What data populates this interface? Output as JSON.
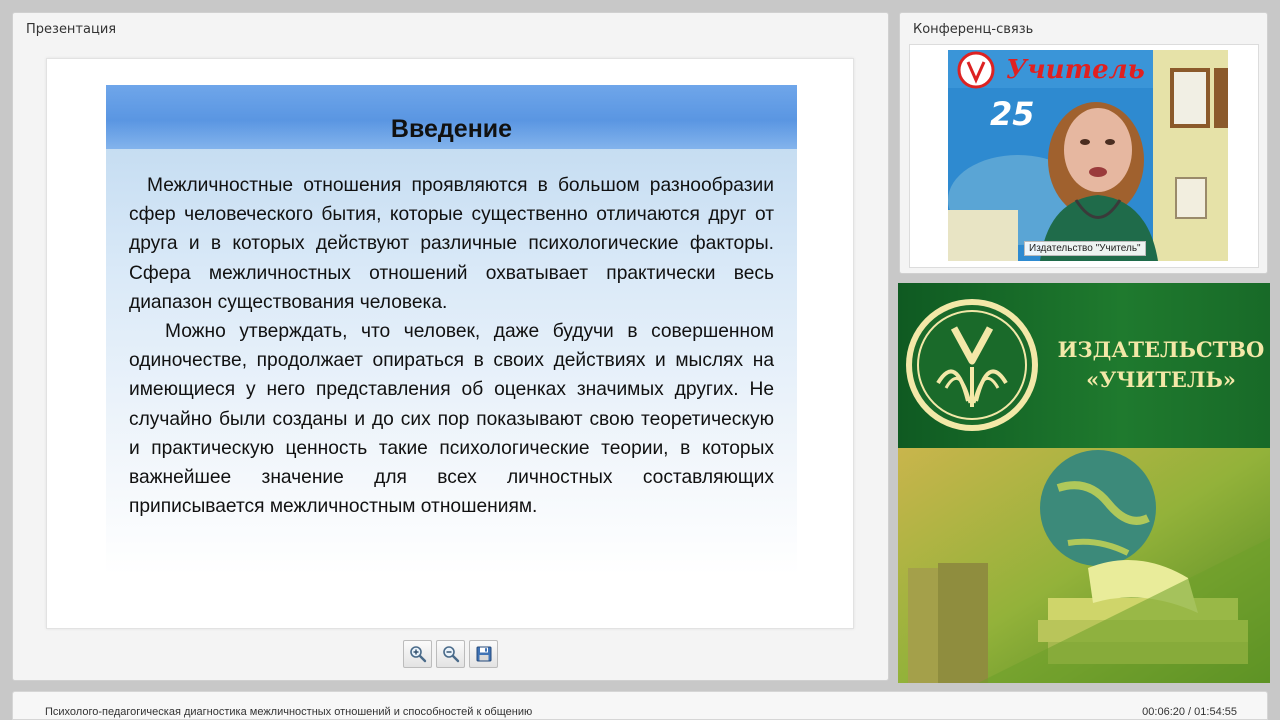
{
  "presentation": {
    "title": "Презентация"
  },
  "slide": {
    "title": "Введение",
    "paragraphs": [
      "Межличностные отношения проявляются в большом разнообразии сфер человеческого бытия, которые существенно отличаются друг от друга и в которых действуют различные психологические факторы. Сфера межличностных отношений охватывает практически весь диапазон существования человека.",
      "Можно утверждать, что человек, даже будучи в совершенном одиночестве, продолжает опираться в своих действиях и мыслях на имеющиеся у него представления об оценках значимых других. Не случайно были созданы и до сих пор показывают свою теоретическую и практическую ценность такие психологические теории, в которых важнейшее значение для всех личностных составляющих приписывается межличностным отношениям."
    ]
  },
  "toolbar": {
    "zoom_in": "zoom-in-icon",
    "zoom_out": "zoom-out-icon",
    "save": "save-icon"
  },
  "conference": {
    "title": "Конференц-связь",
    "speaker_label": "Издательство \"Учитель\"",
    "backdrop_text": "Учитель",
    "backdrop_number": "25"
  },
  "banner": {
    "line1": "ИЗДАТЕЛЬСТВО",
    "line2": "«УЧИТЕЛЬ»"
  },
  "status": {
    "lecture_title": "Психолого-педагогическая диагностика межличностных отношений и способностей к общению",
    "elapsed": "00:06:20",
    "total": "01:54:55",
    "separator": " / "
  },
  "colors": {
    "banner_green": "#1f7a2e",
    "banner_text": "#f3e8a8",
    "slide_header_blue": "#5a96e2"
  }
}
